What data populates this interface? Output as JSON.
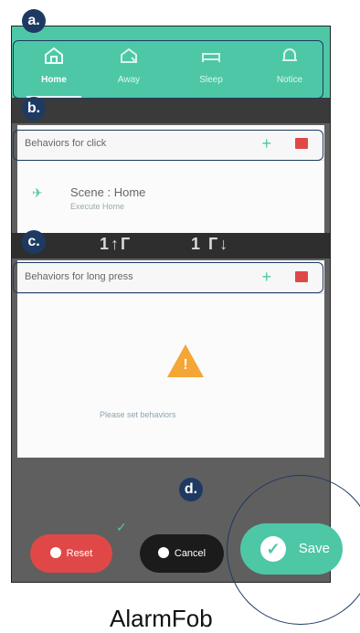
{
  "tabs": [
    {
      "label": "Home",
      "icon": "home-icon",
      "active": true
    },
    {
      "label": "Away",
      "icon": "away-icon",
      "active": false
    },
    {
      "label": "Sleep",
      "icon": "sleep-icon",
      "active": false
    },
    {
      "label": "Notice",
      "icon": "bell-icon",
      "active": false
    }
  ],
  "click_section": {
    "title": "Behaviors for click",
    "item": {
      "title": "Scene : Home",
      "subtitle": "Execute Home",
      "icon": "scene-icon"
    }
  },
  "long_press_section": {
    "title": "Behaviors for long press",
    "empty_text": "Please set behaviors"
  },
  "buttons": {
    "delete": "Reset",
    "cancel": "Cancel",
    "save": "Save"
  },
  "annotations": {
    "a": "a.",
    "b": "b.",
    "c": "c.",
    "d": "d."
  },
  "caption": "AlarmFob",
  "colors": {
    "accent": "#4ec7a6",
    "danger": "#e04848",
    "annotation": "#1e3a63",
    "warning": "#f4a636"
  }
}
